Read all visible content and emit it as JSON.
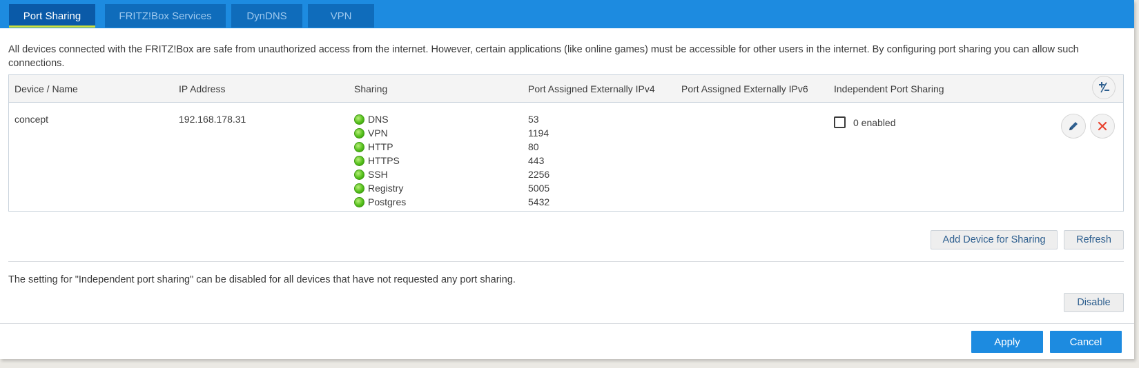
{
  "tabs": [
    {
      "label": "Port Sharing",
      "active": true
    },
    {
      "label": "FRITZ!Box Services",
      "active": false
    },
    {
      "label": "DynDNS",
      "active": false
    },
    {
      "label": "VPN",
      "active": false
    }
  ],
  "intro_text": "All devices connected with the FRITZ!Box are safe from unauthorized access from the internet. However, certain applications (like online games) must be accessible for other users in the internet. By configuring port sharing you can allow such connections.",
  "table": {
    "headers": {
      "device": "Device / Name",
      "ip": "IP Address",
      "sharing": "Sharing",
      "ipv4": "Port Assigned Externally IPv4",
      "ipv6": "Port Assigned Externally IPv6",
      "independent": "Independent Port Sharing"
    },
    "row": {
      "device": "concept",
      "ip": "192.168.178.31",
      "services": [
        {
          "name": "DNS",
          "port": "53"
        },
        {
          "name": "VPN",
          "port": "1194"
        },
        {
          "name": "HTTP",
          "port": "80"
        },
        {
          "name": "HTTPS",
          "port": "443"
        },
        {
          "name": "SSH",
          "port": "2256"
        },
        {
          "name": "Registry",
          "port": "5005"
        },
        {
          "name": "Postgres",
          "port": "5432"
        }
      ],
      "independent_label": "0 enabled",
      "independent_checked": false
    }
  },
  "buttons": {
    "add_device": "Add Device for Sharing",
    "refresh": "Refresh",
    "disable": "Disable",
    "apply": "Apply",
    "cancel": "Cancel"
  },
  "note_text": "The setting for \"Independent port sharing\" can be disabled for all devices that have not requested any port sharing.",
  "icons": {
    "toggle_columns": "plus-minus-icon",
    "edit": "pencil-icon",
    "delete": "close-icon",
    "status": "status-dot-icon"
  },
  "colors": {
    "accent": "#1d8be0",
    "active_tab": "#0a5aa8",
    "tab_underline": "#cfe03b",
    "status_green": "#56c11c",
    "delete_red": "#e8432e"
  }
}
